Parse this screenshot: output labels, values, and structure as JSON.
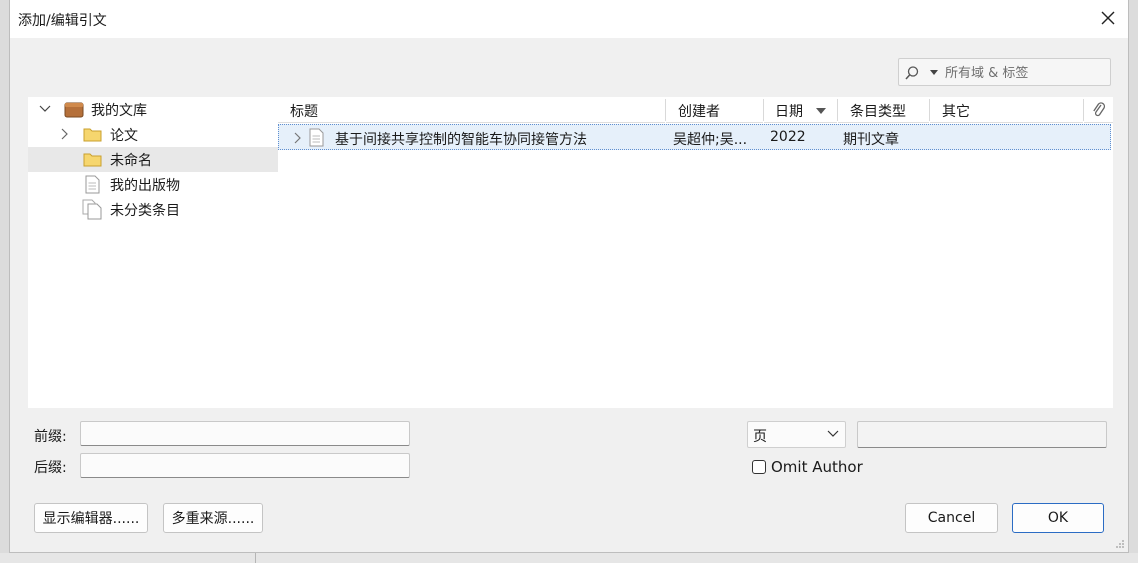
{
  "window": {
    "title": "添加/编辑引文"
  },
  "search": {
    "placeholder": "所有域 & 标签",
    "value": ""
  },
  "library_tree": {
    "root": "我的文库",
    "items": [
      {
        "label": "论文",
        "icon": "folder-icon",
        "expandable": true
      },
      {
        "label": "未命名",
        "icon": "folder-icon",
        "selected": true
      },
      {
        "label": "我的出版物",
        "icon": "document-icon"
      },
      {
        "label": "未分类条目",
        "icon": "documents-icon"
      }
    ]
  },
  "items_table": {
    "columns": [
      "标题",
      "创建者",
      "日期",
      "条目类型",
      "其它"
    ],
    "rows": [
      {
        "title": "基于间接共享控制的智能车协同接管方法",
        "creator": "吴超仲;吴...",
        "date": "2022",
        "type": "期刊文章",
        "extra": ""
      }
    ]
  },
  "citation": {
    "prefix_label": "前缀:",
    "suffix_label": "后缀:",
    "prefix_value": "",
    "suffix_value": "",
    "locator_type": "页",
    "locator_value": "",
    "omit_author_label": "Omit Author",
    "omit_author_checked": false
  },
  "buttons": {
    "show_editor": "显示编辑器......",
    "multiple_sources": "多重来源......",
    "cancel": "Cancel",
    "ok": "OK"
  },
  "colors": {
    "selection": "#e6f0fa",
    "ok_border": "#2b6cc4",
    "folder": "#f3c74c",
    "library": "#b5703a"
  }
}
